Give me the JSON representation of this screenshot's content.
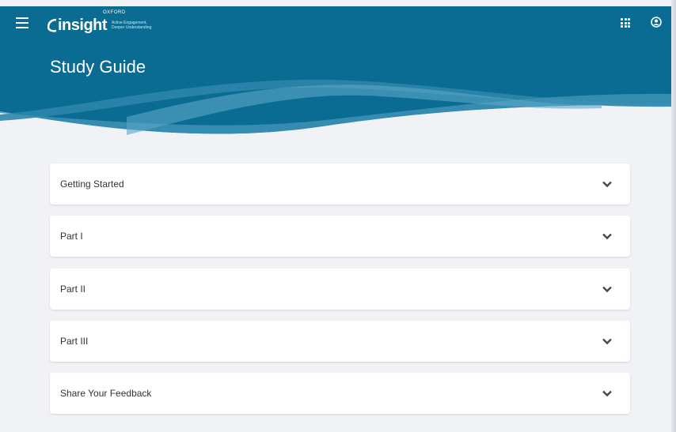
{
  "app": {
    "brand_prefix": "OXFORD",
    "brand_name": "insight",
    "brand_tagline": "Active Engagement, Deeper Understanding"
  },
  "header": {
    "menu_icon": "menu-icon",
    "apps_icon": "apps-grid-icon",
    "account_icon": "account-circle-icon"
  },
  "page": {
    "title": "Study Guide"
  },
  "sections": [
    {
      "label": "Getting Started",
      "icon": "chevron-down-icon"
    },
    {
      "label": "Part I",
      "icon": "chevron-down-icon"
    },
    {
      "label": "Part II",
      "icon": "chevron-down-icon"
    },
    {
      "label": "Part III",
      "icon": "chevron-down-icon"
    },
    {
      "label": "Share Your Feedback",
      "icon": "chevron-down-icon"
    }
  ],
  "colors": {
    "header": "#0a6c93",
    "background": "#f1f2f6"
  }
}
